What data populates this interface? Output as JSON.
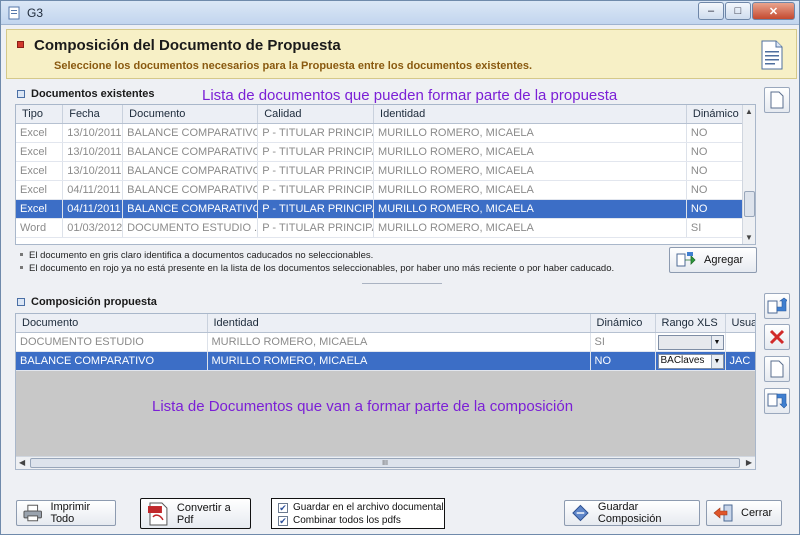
{
  "window": {
    "title": "G3",
    "minimize": "–",
    "maximize": "□",
    "close": "✕"
  },
  "header": {
    "title": "Composición del Documento de Propuesta",
    "subtitle": "Seleccione los documentos necesarios para la Propuesta entre los documentos existentes."
  },
  "existentes": {
    "section_title": "Documentos existentes",
    "annotation": "Lista de documentos que pueden formar parte de la propuesta",
    "columns": [
      "Tipo",
      "Fecha",
      "Documento",
      "Calidad",
      "Identidad",
      "Dinámico"
    ],
    "rows": [
      {
        "tipo": "Excel",
        "fecha": "13/10/2011",
        "documento": "BALANCE COMPARATIVO...",
        "calidad": "P - TITULAR PRINCIPAL",
        "identidad": "MURILLO ROMERO, MICAELA",
        "dinamico": "NO"
      },
      {
        "tipo": "Excel",
        "fecha": "13/10/2011",
        "documento": "BALANCE COMPARATIVO...",
        "calidad": "P - TITULAR PRINCIPAL",
        "identidad": "MURILLO ROMERO, MICAELA",
        "dinamico": "NO"
      },
      {
        "tipo": "Excel",
        "fecha": "13/10/2011",
        "documento": "BALANCE COMPARATIVO...",
        "calidad": "P - TITULAR PRINCIPAL",
        "identidad": "MURILLO ROMERO, MICAELA",
        "dinamico": "NO"
      },
      {
        "tipo": "Excel",
        "fecha": "04/11/2011",
        "documento": "BALANCE COMPARATIVO...",
        "calidad": "P - TITULAR PRINCIPAL",
        "identidad": "MURILLO ROMERO, MICAELA",
        "dinamico": "NO"
      },
      {
        "tipo": "Excel",
        "fecha": "04/11/2011",
        "documento": "BALANCE COMPARATIVO...",
        "calidad": "P - TITULAR PRINCIPAL",
        "identidad": "MURILLO ROMERO, MICAELA",
        "dinamico": "NO"
      },
      {
        "tipo": "Word",
        "fecha": "01/03/2012",
        "documento": "DOCUMENTO ESTUDIO ...",
        "calidad": "P - TITULAR PRINCIPAL",
        "identidad": "MURILLO ROMERO, MICAELA",
        "dinamico": "SI"
      }
    ],
    "selected_index": 4,
    "notes": [
      "El documento en gris claro identifica a documentos caducados no seleccionables.",
      "El documento en rojo ya no está presente en la lista de los documentos seleccionables, por haber uno más reciente o por haber caducado."
    ],
    "add_button": "Agregar"
  },
  "composicion": {
    "section_title": "Composición propuesta",
    "annotation": "Lista de Documentos que van a formar parte de la composición",
    "columns": [
      "Documento",
      "Identidad",
      "Dinámico",
      "Rango XLS",
      "Usuari"
    ],
    "rows": [
      {
        "documento": "DOCUMENTO ESTUDIO",
        "identidad": "MURILLO ROMERO, MICAELA",
        "dinamico": "SI",
        "rango": "",
        "usuario": ""
      },
      {
        "documento": "BALANCE COMPARATIVO",
        "identidad": "MURILLO ROMERO, MICAELA",
        "dinamico": "NO",
        "rango": "BAClaves",
        "usuario": "JAC"
      }
    ],
    "selected_index": 1,
    "scroll_grip": "III"
  },
  "footer": {
    "print_all": "Imprimir Todo",
    "convert_pdf": "Convertir a Pdf",
    "check_save": "Guardar en el archivo documental",
    "check_combine": "Combinar todos los pdfs",
    "save_composition": "Guardar Composición",
    "close": "Cerrar"
  },
  "colors": {
    "selection": "#3c6ec6",
    "annotation": "#7b1fd6",
    "header_bg": "#f7f0c6"
  }
}
